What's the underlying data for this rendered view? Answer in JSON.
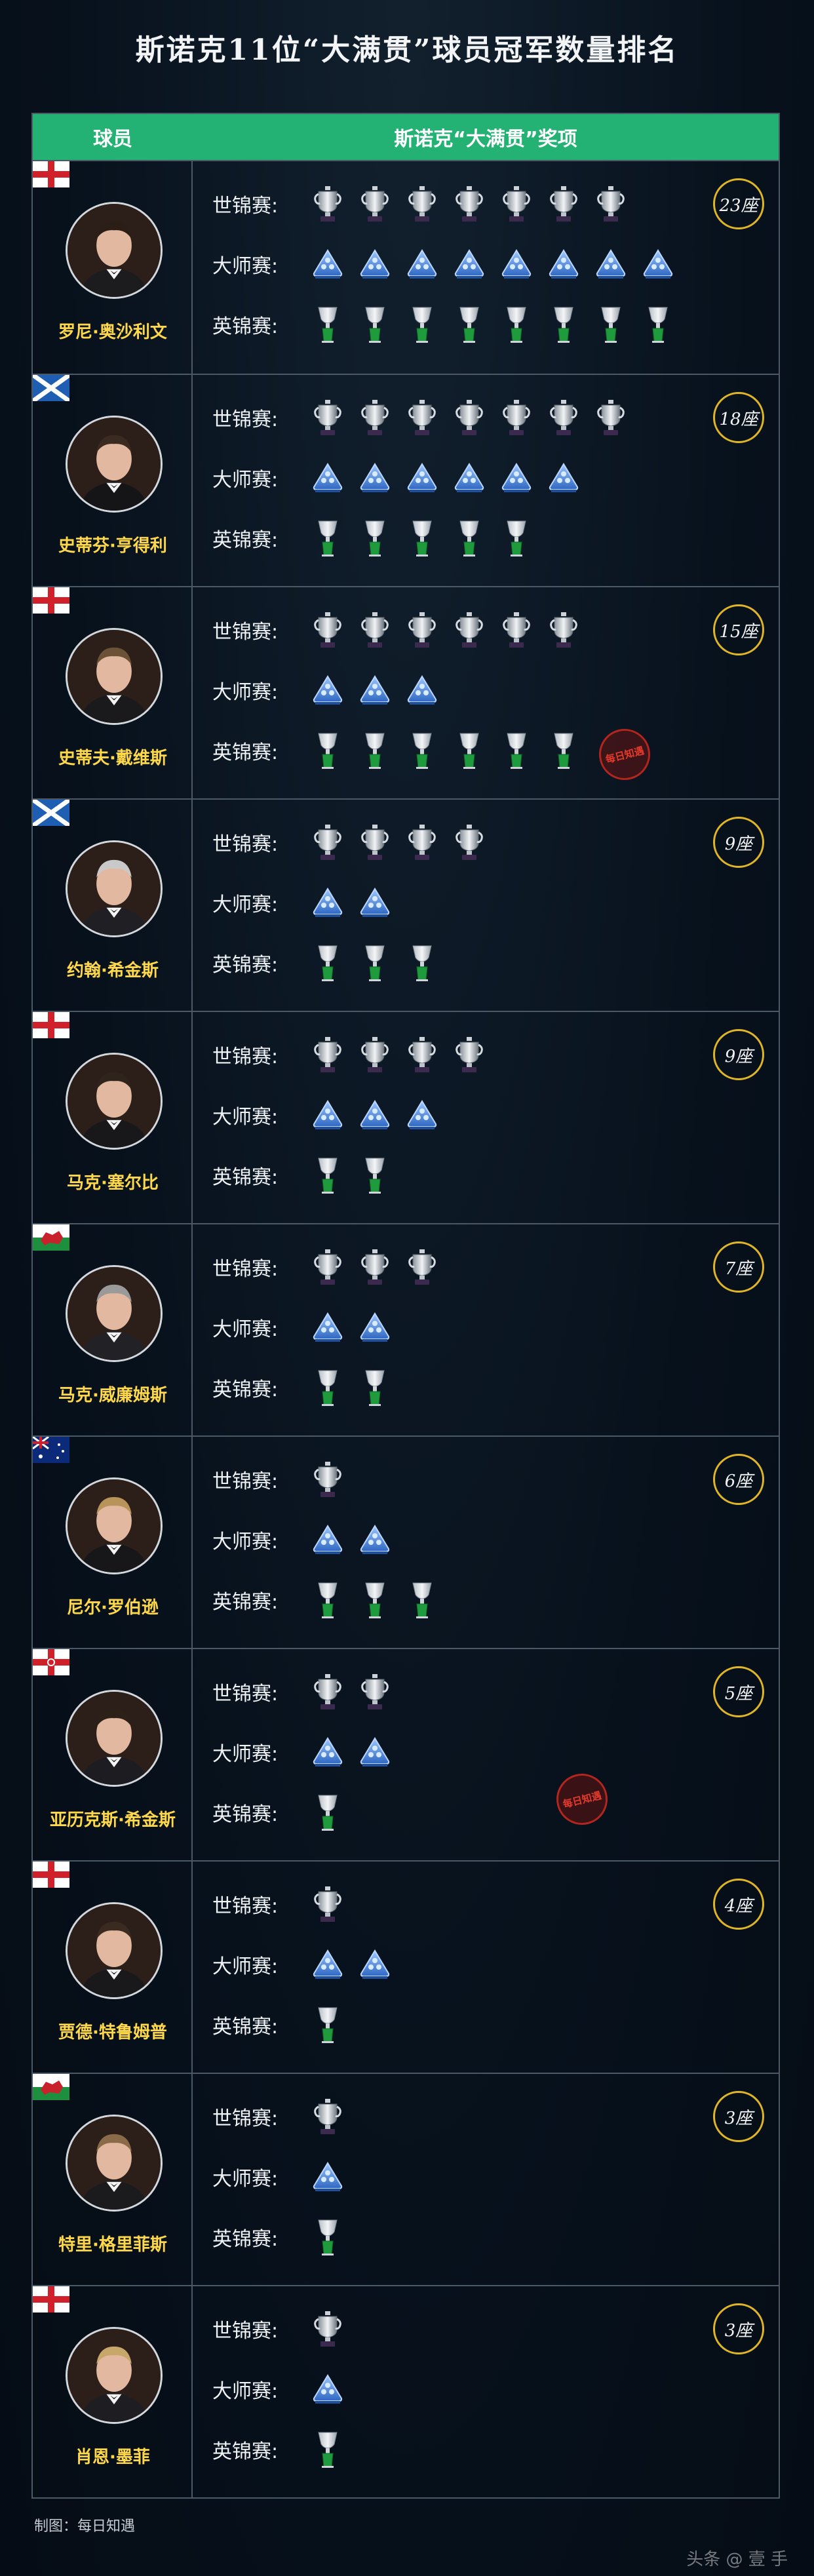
{
  "title": "斯诺克11位“大满贯”球员冠军数量排名",
  "header": {
    "player_col": "球员",
    "award_col": "斯诺克“大满贯”奖项"
  },
  "labels": {
    "world": "世锦赛:",
    "masters": "大师赛:",
    "uk": "英锦赛:"
  },
  "colors": {
    "header_green": "#23b274",
    "name_gold": "#ffd84a",
    "badge_gold": "#e0b526",
    "masters_blue": "#3f7fd6",
    "uk_green": "#1f9a3c"
  },
  "players": [
    {
      "name": "罗尼·奥沙利文",
      "flag": "england",
      "world": 7,
      "masters": 8,
      "uk": 8,
      "total": "23座"
    },
    {
      "name": "史蒂芬·亨得利",
      "flag": "scotland",
      "world": 7,
      "masters": 6,
      "uk": 5,
      "total": "18座"
    },
    {
      "name": "史蒂夫·戴维斯",
      "flag": "england",
      "world": 6,
      "masters": 3,
      "uk": 6,
      "total": "15座"
    },
    {
      "name": "约翰·希金斯",
      "flag": "scotland",
      "world": 4,
      "masters": 2,
      "uk": 3,
      "total": "9座"
    },
    {
      "name": "马克·塞尔比",
      "flag": "england",
      "world": 4,
      "masters": 3,
      "uk": 2,
      "total": "9座"
    },
    {
      "name": "马克·威廉姆斯",
      "flag": "wales",
      "world": 3,
      "masters": 2,
      "uk": 2,
      "total": "7座"
    },
    {
      "name": "尼尔·罗伯逊",
      "flag": "australia",
      "world": 1,
      "masters": 2,
      "uk": 3,
      "total": "6座"
    },
    {
      "name": "亚历克斯·希金斯",
      "flag": "northern-ireland",
      "world": 2,
      "masters": 2,
      "uk": 1,
      "total": "5座"
    },
    {
      "name": "贾德·特鲁姆普",
      "flag": "england",
      "world": 1,
      "masters": 2,
      "uk": 1,
      "total": "4座"
    },
    {
      "name": "特里·格里菲斯",
      "flag": "wales",
      "world": 1,
      "masters": 1,
      "uk": 1,
      "total": "3座"
    },
    {
      "name": "肖恩·墨菲",
      "flag": "england",
      "world": 1,
      "masters": 1,
      "uk": 1,
      "total": "3座"
    }
  ],
  "stamp_text": "每日知遇",
  "footer": {
    "credit": "制图：每日知遇"
  },
  "watermark": "头条 @ 壹 手"
}
